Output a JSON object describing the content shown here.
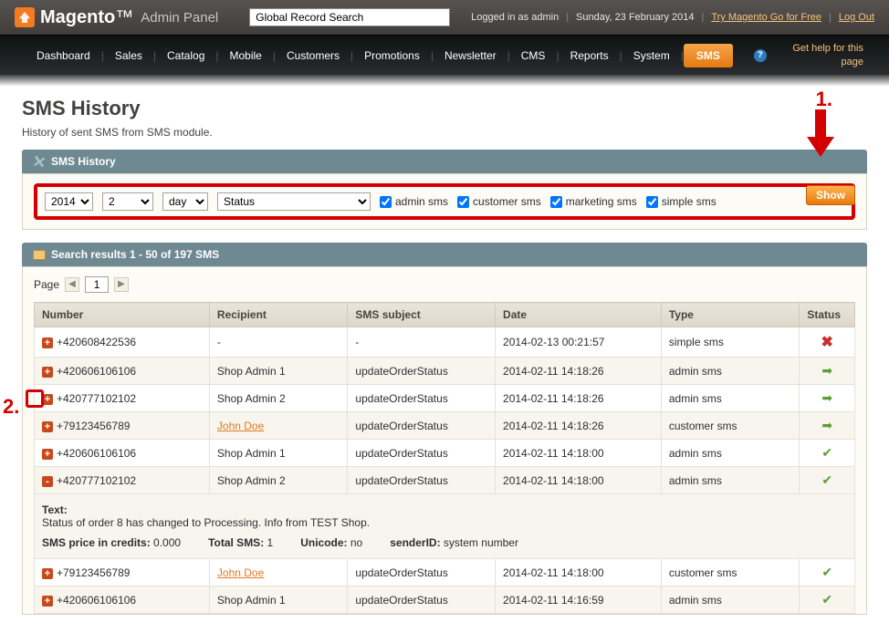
{
  "header": {
    "brand_main": "Magento",
    "brand_tm": "™",
    "brand_sub": "Admin Panel",
    "search_placeholder": "Global Record Search",
    "logged_in": "Logged in as admin",
    "date": "Sunday, 23 February 2014",
    "try_link": "Try Magento Go for Free",
    "logout": "Log Out"
  },
  "nav": {
    "items": [
      "Dashboard",
      "Sales",
      "Catalog",
      "Mobile",
      "Customers",
      "Promotions",
      "Newsletter",
      "CMS",
      "Reports",
      "System",
      "SMS"
    ],
    "active_index": 10,
    "help": "Get help for this page"
  },
  "page": {
    "title": "SMS History",
    "subtitle": "History of sent SMS from SMS module."
  },
  "filter": {
    "panel_title": "SMS History",
    "year": "2014",
    "month": "2",
    "day": "day",
    "status": "Status",
    "checks": [
      {
        "label": "admin sms",
        "checked": true
      },
      {
        "label": "customer sms",
        "checked": true
      },
      {
        "label": "marketing sms",
        "checked": true
      },
      {
        "label": "simple sms",
        "checked": true
      }
    ],
    "show": "Show"
  },
  "results": {
    "title": "Search results 1 - 50 of 197 SMS",
    "page_label": "Page",
    "page_value": "1",
    "columns": [
      "Number",
      "Recipient",
      "SMS subject",
      "Date",
      "Type",
      "Status"
    ],
    "rows": [
      {
        "expand": "+",
        "number": "+420608422536",
        "recipient": "-",
        "subject": "-",
        "date": "2014-02-13 00:21:57",
        "type": "simple sms",
        "status": "x"
      },
      {
        "expand": "+",
        "number": "+420606106106",
        "recipient": "Shop Admin 1",
        "subject": "updateOrderStatus",
        "date": "2014-02-11 14:18:26",
        "type": "admin sms",
        "status": "arrow"
      },
      {
        "expand": "+",
        "number": "+420777102102",
        "recipient": "Shop Admin 2",
        "subject": "updateOrderStatus",
        "date": "2014-02-11 14:18:26",
        "type": "admin sms",
        "status": "arrow"
      },
      {
        "expand": "+",
        "number": "+79123456789",
        "recipient": "John Doe",
        "recipient_link": true,
        "subject": "updateOrderStatus",
        "date": "2014-02-11 14:18:26",
        "type": "customer sms",
        "status": "arrow"
      },
      {
        "expand": "+",
        "number": "+420606106106",
        "recipient": "Shop Admin 1",
        "subject": "updateOrderStatus",
        "date": "2014-02-11 14:18:00",
        "type": "admin sms",
        "status": "check"
      },
      {
        "expand": "-",
        "number": "+420777102102",
        "recipient": "Shop Admin 2",
        "subject": "updateOrderStatus",
        "date": "2014-02-11 14:18:00",
        "type": "admin sms",
        "status": "check"
      }
    ],
    "detail": {
      "text_label": "Text:",
      "text": "Status of order 8 has changed to Processing. Info from TEST Shop.",
      "price_label": "SMS price in credits:",
      "price": "0.000",
      "total_label": "Total SMS:",
      "total": "1",
      "unicode_label": "Unicode:",
      "unicode": "no",
      "sender_label": "senderID:",
      "sender": "system number"
    },
    "rows2": [
      {
        "expand": "+",
        "number": "+79123456789",
        "recipient": "John Doe",
        "recipient_link": true,
        "subject": "updateOrderStatus",
        "date": "2014-02-11 14:18:00",
        "type": "customer sms",
        "status": "check"
      },
      {
        "expand": "+",
        "number": "+420606106106",
        "recipient": "Shop Admin 1",
        "subject": "updateOrderStatus",
        "date": "2014-02-11 14:16:59",
        "type": "admin sms",
        "status": "check"
      }
    ]
  },
  "annot": {
    "one": "1.",
    "two": "2."
  }
}
